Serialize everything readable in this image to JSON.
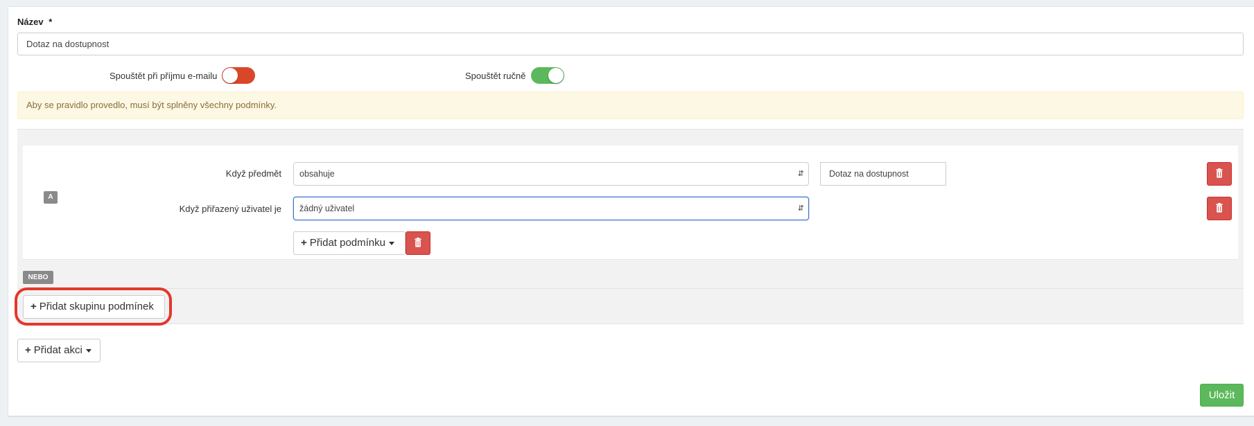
{
  "form": {
    "name_label": "Název",
    "required_mark": "*",
    "name_value": "Dotaz na dostupnost"
  },
  "toggles": [
    {
      "label": "Spouštět při příjmu e-mailu",
      "state": "off",
      "color": "#d9472b"
    },
    {
      "label": "Spouštět ručně",
      "state": "on",
      "color": "#5cb85c"
    }
  ],
  "alert": {
    "text": "Aby se pravidlo provedlo, musí být splněny všechny podmínky."
  },
  "condition_group": {
    "badge": "A",
    "conditions": [
      {
        "label": "Když předmět",
        "operator": "obsahuje",
        "value": "Dotaz na dostupnost"
      },
      {
        "label": "Když přiřazený uživatel je",
        "operator": "žádný uživatel"
      }
    ],
    "add_condition_label": "Přidat podmínku"
  },
  "or_badge": "NEBO",
  "add_group_label": "Přidat skupinu podmínek",
  "add_action_label": "Přidat akci",
  "save_label": "Uložit",
  "colors": {
    "danger": "#d9534f",
    "success": "#5cb85c",
    "highlight": "#e5372a",
    "alert_bg": "#fcf8e3"
  }
}
